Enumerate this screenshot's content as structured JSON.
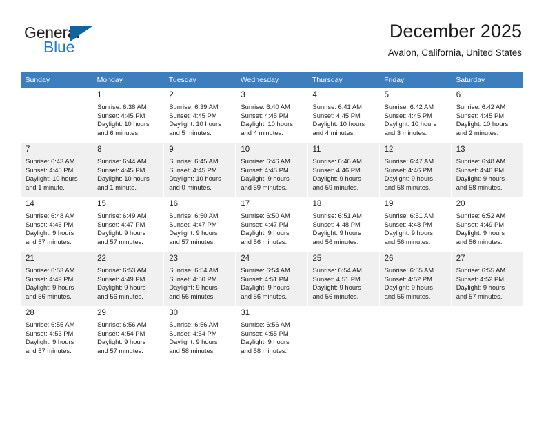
{
  "brand": {
    "name_part1": "General",
    "name_part2": "Blue",
    "triangle_color": "#11659f",
    "blue_color": "#1f7ac4"
  },
  "header": {
    "title": "December 2025",
    "subtitle": "Avalon, California, United States"
  },
  "theme": {
    "header_row_bg": "#3c7ebe",
    "header_row_text": "#ffffff",
    "shaded_row_bg": "#f0f0f0",
    "cell_text": "#222222"
  },
  "weekday_headers": [
    "Sunday",
    "Monday",
    "Tuesday",
    "Wednesday",
    "Thursday",
    "Friday",
    "Saturday"
  ],
  "weeks": [
    {
      "shaded": false,
      "days": [
        {
          "empty": true
        },
        {
          "empty": false,
          "day": "1",
          "sunrise": "Sunrise: 6:38 AM",
          "sunset": "Sunset: 4:45 PM",
          "daylight_line1": "Daylight: 10 hours",
          "daylight_line2": "and 6 minutes."
        },
        {
          "empty": false,
          "day": "2",
          "sunrise": "Sunrise: 6:39 AM",
          "sunset": "Sunset: 4:45 PM",
          "daylight_line1": "Daylight: 10 hours",
          "daylight_line2": "and 5 minutes."
        },
        {
          "empty": false,
          "day": "3",
          "sunrise": "Sunrise: 6:40 AM",
          "sunset": "Sunset: 4:45 PM",
          "daylight_line1": "Daylight: 10 hours",
          "daylight_line2": "and 4 minutes."
        },
        {
          "empty": false,
          "day": "4",
          "sunrise": "Sunrise: 6:41 AM",
          "sunset": "Sunset: 4:45 PM",
          "daylight_line1": "Daylight: 10 hours",
          "daylight_line2": "and 4 minutes."
        },
        {
          "empty": false,
          "day": "5",
          "sunrise": "Sunrise: 6:42 AM",
          "sunset": "Sunset: 4:45 PM",
          "daylight_line1": "Daylight: 10 hours",
          "daylight_line2": "and 3 minutes."
        },
        {
          "empty": false,
          "day": "6",
          "sunrise": "Sunrise: 6:42 AM",
          "sunset": "Sunset: 4:45 PM",
          "daylight_line1": "Daylight: 10 hours",
          "daylight_line2": "and 2 minutes."
        }
      ]
    },
    {
      "shaded": true,
      "days": [
        {
          "empty": false,
          "day": "7",
          "sunrise": "Sunrise: 6:43 AM",
          "sunset": "Sunset: 4:45 PM",
          "daylight_line1": "Daylight: 10 hours",
          "daylight_line2": "and 1 minute."
        },
        {
          "empty": false,
          "day": "8",
          "sunrise": "Sunrise: 6:44 AM",
          "sunset": "Sunset: 4:45 PM",
          "daylight_line1": "Daylight: 10 hours",
          "daylight_line2": "and 1 minute."
        },
        {
          "empty": false,
          "day": "9",
          "sunrise": "Sunrise: 6:45 AM",
          "sunset": "Sunset: 4:45 PM",
          "daylight_line1": "Daylight: 10 hours",
          "daylight_line2": "and 0 minutes."
        },
        {
          "empty": false,
          "day": "10",
          "sunrise": "Sunrise: 6:46 AM",
          "sunset": "Sunset: 4:45 PM",
          "daylight_line1": "Daylight: 9 hours",
          "daylight_line2": "and 59 minutes."
        },
        {
          "empty": false,
          "day": "11",
          "sunrise": "Sunrise: 6:46 AM",
          "sunset": "Sunset: 4:46 PM",
          "daylight_line1": "Daylight: 9 hours",
          "daylight_line2": "and 59 minutes."
        },
        {
          "empty": false,
          "day": "12",
          "sunrise": "Sunrise: 6:47 AM",
          "sunset": "Sunset: 4:46 PM",
          "daylight_line1": "Daylight: 9 hours",
          "daylight_line2": "and 58 minutes."
        },
        {
          "empty": false,
          "day": "13",
          "sunrise": "Sunrise: 6:48 AM",
          "sunset": "Sunset: 4:46 PM",
          "daylight_line1": "Daylight: 9 hours",
          "daylight_line2": "and 58 minutes."
        }
      ]
    },
    {
      "shaded": false,
      "days": [
        {
          "empty": false,
          "day": "14",
          "sunrise": "Sunrise: 6:48 AM",
          "sunset": "Sunset: 4:46 PM",
          "daylight_line1": "Daylight: 9 hours",
          "daylight_line2": "and 57 minutes."
        },
        {
          "empty": false,
          "day": "15",
          "sunrise": "Sunrise: 6:49 AM",
          "sunset": "Sunset: 4:47 PM",
          "daylight_line1": "Daylight: 9 hours",
          "daylight_line2": "and 57 minutes."
        },
        {
          "empty": false,
          "day": "16",
          "sunrise": "Sunrise: 6:50 AM",
          "sunset": "Sunset: 4:47 PM",
          "daylight_line1": "Daylight: 9 hours",
          "daylight_line2": "and 57 minutes."
        },
        {
          "empty": false,
          "day": "17",
          "sunrise": "Sunrise: 6:50 AM",
          "sunset": "Sunset: 4:47 PM",
          "daylight_line1": "Daylight: 9 hours",
          "daylight_line2": "and 56 minutes."
        },
        {
          "empty": false,
          "day": "18",
          "sunrise": "Sunrise: 6:51 AM",
          "sunset": "Sunset: 4:48 PM",
          "daylight_line1": "Daylight: 9 hours",
          "daylight_line2": "and 56 minutes."
        },
        {
          "empty": false,
          "day": "19",
          "sunrise": "Sunrise: 6:51 AM",
          "sunset": "Sunset: 4:48 PM",
          "daylight_line1": "Daylight: 9 hours",
          "daylight_line2": "and 56 minutes."
        },
        {
          "empty": false,
          "day": "20",
          "sunrise": "Sunrise: 6:52 AM",
          "sunset": "Sunset: 4:49 PM",
          "daylight_line1": "Daylight: 9 hours",
          "daylight_line2": "and 56 minutes."
        }
      ]
    },
    {
      "shaded": true,
      "days": [
        {
          "empty": false,
          "day": "21",
          "sunrise": "Sunrise: 6:53 AM",
          "sunset": "Sunset: 4:49 PM",
          "daylight_line1": "Daylight: 9 hours",
          "daylight_line2": "and 56 minutes."
        },
        {
          "empty": false,
          "day": "22",
          "sunrise": "Sunrise: 6:53 AM",
          "sunset": "Sunset: 4:49 PM",
          "daylight_line1": "Daylight: 9 hours",
          "daylight_line2": "and 56 minutes."
        },
        {
          "empty": false,
          "day": "23",
          "sunrise": "Sunrise: 6:54 AM",
          "sunset": "Sunset: 4:50 PM",
          "daylight_line1": "Daylight: 9 hours",
          "daylight_line2": "and 56 minutes."
        },
        {
          "empty": false,
          "day": "24",
          "sunrise": "Sunrise: 6:54 AM",
          "sunset": "Sunset: 4:51 PM",
          "daylight_line1": "Daylight: 9 hours",
          "daylight_line2": "and 56 minutes."
        },
        {
          "empty": false,
          "day": "25",
          "sunrise": "Sunrise: 6:54 AM",
          "sunset": "Sunset: 4:51 PM",
          "daylight_line1": "Daylight: 9 hours",
          "daylight_line2": "and 56 minutes."
        },
        {
          "empty": false,
          "day": "26",
          "sunrise": "Sunrise: 6:55 AM",
          "sunset": "Sunset: 4:52 PM",
          "daylight_line1": "Daylight: 9 hours",
          "daylight_line2": "and 56 minutes."
        },
        {
          "empty": false,
          "day": "27",
          "sunrise": "Sunrise: 6:55 AM",
          "sunset": "Sunset: 4:52 PM",
          "daylight_line1": "Daylight: 9 hours",
          "daylight_line2": "and 57 minutes."
        }
      ]
    },
    {
      "shaded": false,
      "days": [
        {
          "empty": false,
          "day": "28",
          "sunrise": "Sunrise: 6:55 AM",
          "sunset": "Sunset: 4:53 PM",
          "daylight_line1": "Daylight: 9 hours",
          "daylight_line2": "and 57 minutes."
        },
        {
          "empty": false,
          "day": "29",
          "sunrise": "Sunrise: 6:56 AM",
          "sunset": "Sunset: 4:54 PM",
          "daylight_line1": "Daylight: 9 hours",
          "daylight_line2": "and 57 minutes."
        },
        {
          "empty": false,
          "day": "30",
          "sunrise": "Sunrise: 6:56 AM",
          "sunset": "Sunset: 4:54 PM",
          "daylight_line1": "Daylight: 9 hours",
          "daylight_line2": "and 58 minutes."
        },
        {
          "empty": false,
          "day": "31",
          "sunrise": "Sunrise: 6:56 AM",
          "sunset": "Sunset: 4:55 PM",
          "daylight_line1": "Daylight: 9 hours",
          "daylight_line2": "and 58 minutes."
        },
        {
          "empty": true
        },
        {
          "empty": true
        },
        {
          "empty": true
        }
      ]
    }
  ]
}
